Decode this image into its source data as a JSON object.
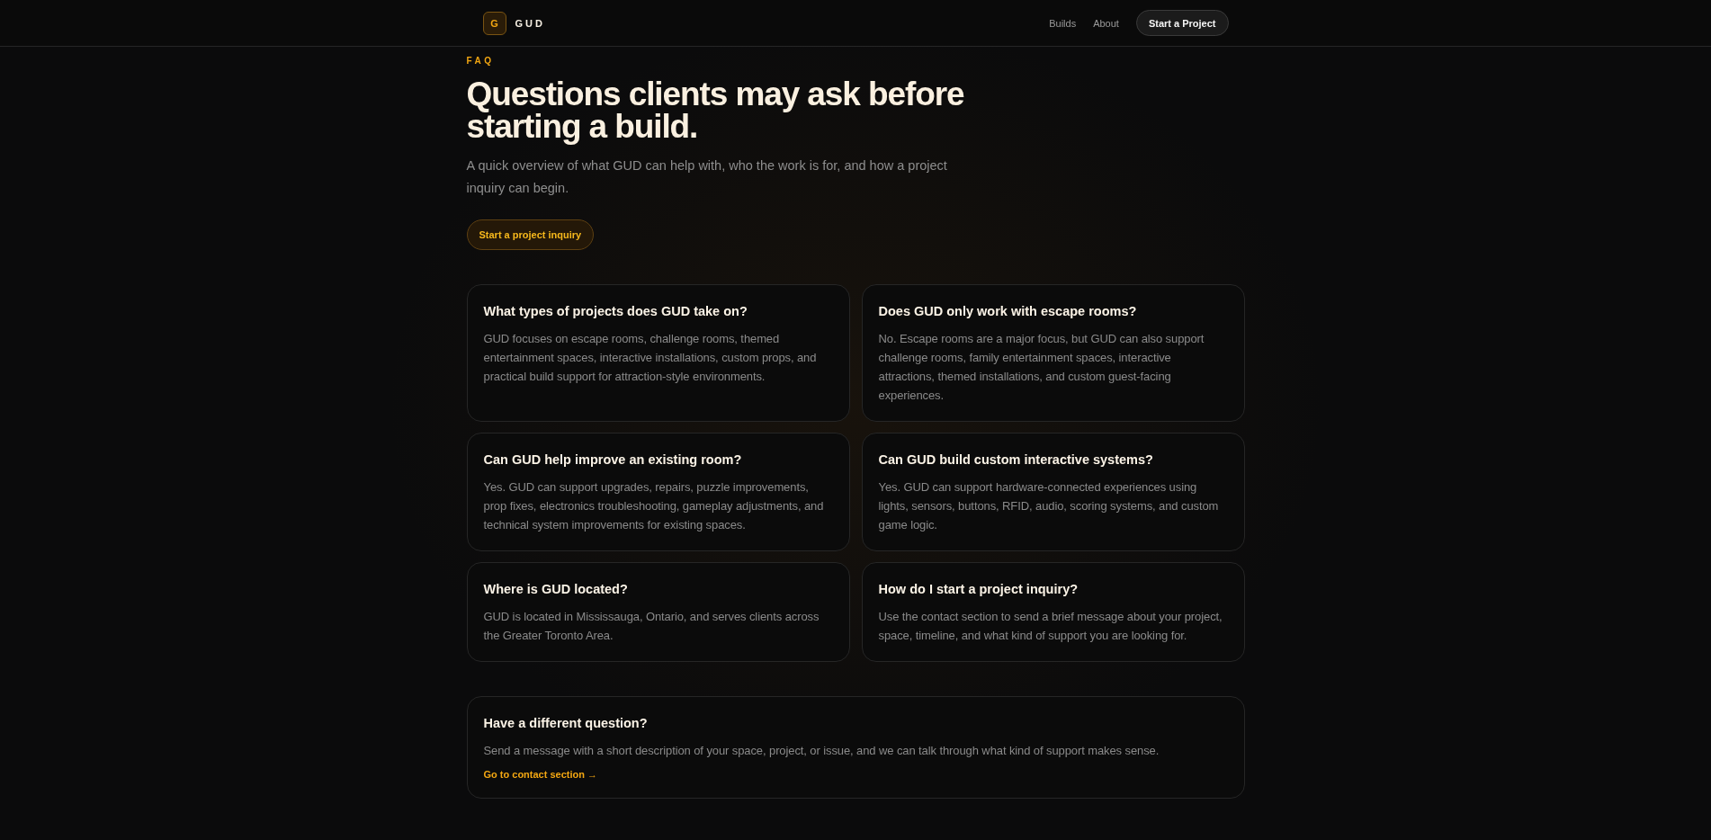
{
  "header": {
    "logo": {
      "mark": "G",
      "name": "GUD"
    },
    "nav": [
      "Builds",
      "About"
    ],
    "cta": "Start a Project"
  },
  "hero": {
    "eyebrow": "FAQ",
    "title": "Questions clients may ask before starting a build.",
    "intro": "A quick overview of what GUD can help with, who the work is for, and how a project inquiry can begin.",
    "button": "Start a project inquiry"
  },
  "faqs": [
    {
      "question": "What types of projects does GUD take on?",
      "answer": "GUD focuses on escape rooms, challenge rooms, themed entertainment spaces, interactive installations, custom props, and practical build support for attraction-style environments."
    },
    {
      "question": "Does GUD only work with escape rooms?",
      "answer": "No. Escape rooms are a major focus, but GUD can also support challenge rooms, family entertainment spaces, interactive attractions, themed installations, and custom guest-facing experiences."
    },
    {
      "question": "Can GUD help improve an existing room?",
      "answer": "Yes. GUD can support upgrades, repairs, puzzle improvements, prop fixes, electronics troubleshooting, gameplay adjustments, and technical system improvements for existing spaces."
    },
    {
      "question": "Can GUD build custom interactive systems?",
      "answer": "Yes. GUD can support hardware-connected experiences using lights, sensors, buttons, RFID, audio, scoring systems, and custom game logic."
    },
    {
      "question": "Where is GUD located?",
      "answer": "GUD is located in Mississauga, Ontario, and serves clients across the Greater Toronto Area."
    },
    {
      "question": "How do I start a project inquiry?",
      "answer": "Use the contact section to send a brief message about your project, space, timeline, and what kind of support you are looking for."
    }
  ],
  "contact_card": {
    "title": "Have a different question?",
    "text": "Send a message with a short description of your space, project, or issue, and we can talk through what kind of support makes sense.",
    "link": "Go to contact section →"
  }
}
